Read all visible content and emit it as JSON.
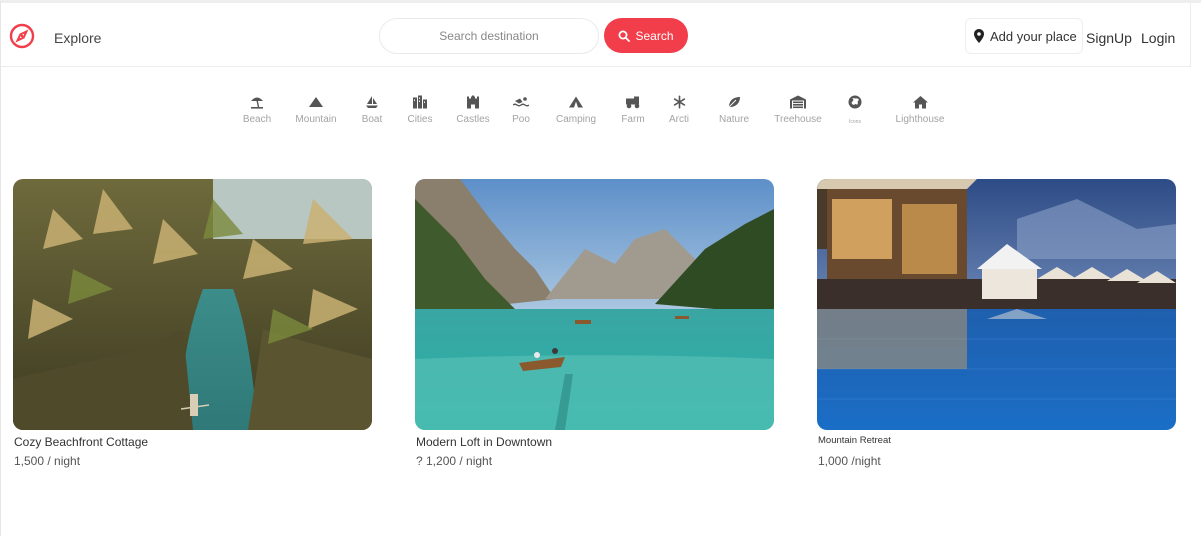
{
  "nav": {
    "explore_label": "Explore",
    "search_placeholder": "Search destination",
    "search_button": "Search",
    "add_place_label": "Add your place",
    "signup_label": "SignUp",
    "login_label": "Login"
  },
  "colors": {
    "accent": "#f23d4a",
    "category_text": "#a3a3a3"
  },
  "categories": [
    {
      "label": "Beach",
      "icon": "beach-umbrella-icon"
    },
    {
      "label": "Mountain",
      "icon": "mountain-icon"
    },
    {
      "label": "Boat",
      "icon": "boat-icon"
    },
    {
      "label": "Cities",
      "icon": "city-icon"
    },
    {
      "label": "Castles",
      "icon": "castle-icon"
    },
    {
      "label": "Poo",
      "icon": "swimmer-icon"
    },
    {
      "label": "Camping",
      "icon": "tent-icon"
    },
    {
      "label": "Farm",
      "icon": "tractor-icon"
    },
    {
      "label": "Arcti",
      "icon": "snowflake-icon"
    },
    {
      "label": "Nature",
      "icon": "leaf-icon"
    },
    {
      "label": "Treehouse",
      "icon": "warehouse-icon"
    },
    {
      "label": "Icons",
      "icon": "globe-icon"
    },
    {
      "label": "Lighthouse",
      "icon": "house-icon"
    }
  ],
  "listings": [
    {
      "title": "Cozy Beachfront Cottage",
      "price": "1,500 / night",
      "image": "tropical-river-photo"
    },
    {
      "title": "Modern Loft in Downtown",
      "price": "? 1,200 / night",
      "image": "mountain-lake-photo"
    },
    {
      "title": "Mountain Retreat",
      "price": "1,000 /night",
      "image": "resort-pool-photo"
    }
  ]
}
